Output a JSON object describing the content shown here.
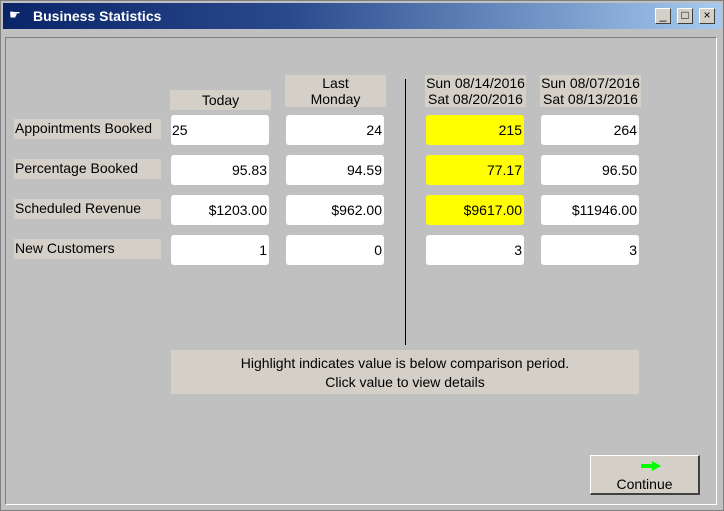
{
  "window": {
    "title": "Business Statistics",
    "icon": "hand-pointer-icon"
  },
  "columns": [
    {
      "label": "Today"
    },
    {
      "label": "Last\nMonday"
    },
    {
      "label": "Sun 08/14/2016\nSat 08/20/2016"
    },
    {
      "label": "Sun 08/07/2016\nSat 08/13/2016"
    }
  ],
  "rows": [
    {
      "label": "Appointments Booked",
      "values": [
        "25",
        "24",
        "215",
        "264"
      ],
      "highlight": [
        false,
        false,
        true,
        false
      ]
    },
    {
      "label": "Percentage Booked",
      "values": [
        "95.83",
        "94.59",
        "77.17",
        "96.50"
      ],
      "highlight": [
        false,
        false,
        true,
        false
      ]
    },
    {
      "label": "Scheduled Revenue",
      "values": [
        "$1203.00",
        "$962.00",
        "$9617.00",
        "$11946.00"
      ],
      "highlight": [
        false,
        false,
        true,
        false
      ]
    },
    {
      "label": "New Customers",
      "values": [
        "1",
        "0",
        "3",
        "3"
      ],
      "highlight": [
        false,
        false,
        false,
        false
      ]
    }
  ],
  "note": {
    "line1": "Highlight indicates value is below comparison period.",
    "line2": "Click value to view details"
  },
  "continue_button": {
    "label": "Continue",
    "icon": "green-arrow-icon"
  },
  "colors": {
    "highlight": "#ffff00",
    "title_bar": "#0a246a",
    "arrow": "#00ff00"
  }
}
